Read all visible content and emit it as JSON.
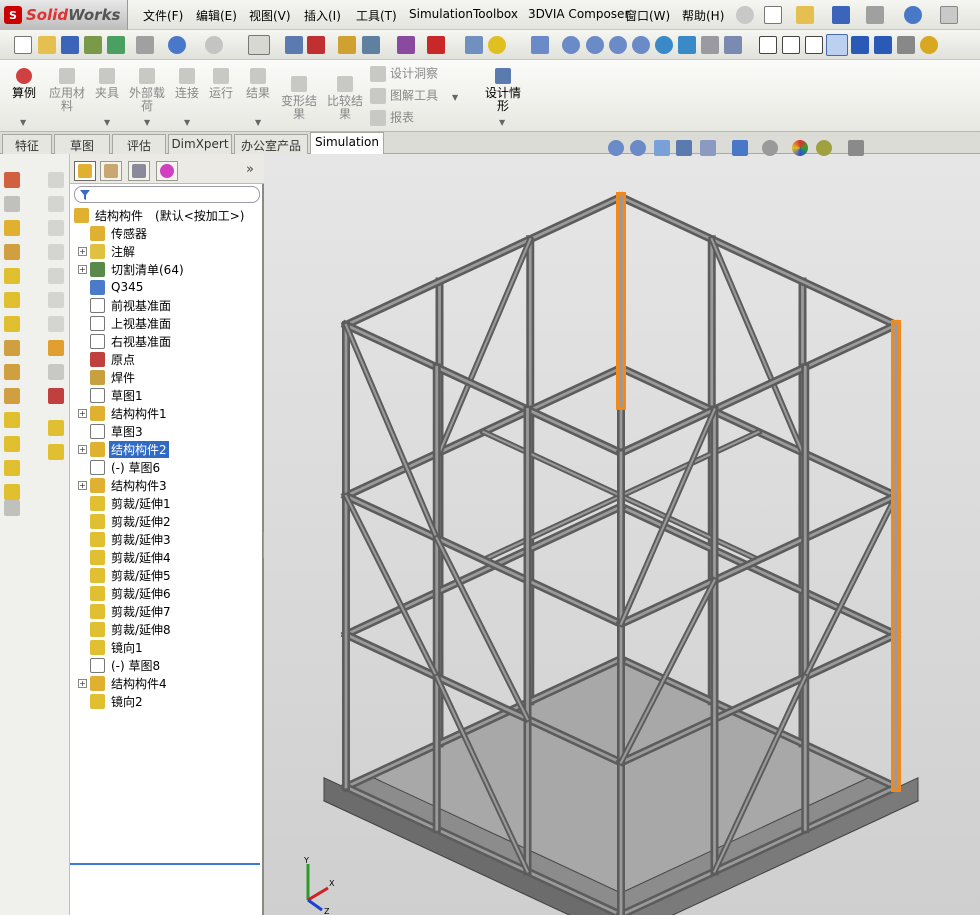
{
  "app": {
    "name_red": "Solid",
    "name_gray": "Works"
  },
  "menu": [
    "文件(F)",
    "编辑(E)",
    "视图(V)",
    "插入(I)",
    "工具(T)",
    "Simulation",
    "Toolbox",
    "3DVIA Composer",
    "窗口(W)",
    "帮助(H)"
  ],
  "commands": [
    {
      "label": "算例",
      "enabled": true
    },
    {
      "label": "应用材料",
      "enabled": false
    },
    {
      "label": "夹具",
      "enabled": false
    },
    {
      "label": "外部载荷",
      "enabled": false
    },
    {
      "label": "连接",
      "enabled": false
    },
    {
      "label": "运行",
      "enabled": false
    },
    {
      "label": "结果",
      "enabled": false
    },
    {
      "label": "变形结果",
      "enabled": false
    },
    {
      "label": "比较结果",
      "enabled": false
    },
    {
      "label": "设计洞察",
      "enabled": false
    },
    {
      "label": "图解工具",
      "enabled": false
    },
    {
      "label": "报表",
      "enabled": false
    },
    {
      "label": "设计情形",
      "enabled": true
    }
  ],
  "tabs": [
    {
      "label": "特征",
      "active": false
    },
    {
      "label": "草图",
      "active": false
    },
    {
      "label": "评估",
      "active": false
    },
    {
      "label": "DimXpert",
      "active": false
    },
    {
      "label": "办公室产品",
      "active": false
    },
    {
      "label": "Simulation",
      "active": true
    }
  ],
  "tree": {
    "root": {
      "label": "结构构件",
      "config": "(默认<按加工>)"
    },
    "nodes": [
      {
        "label": "传感器",
        "expandable": false,
        "icon": "sensor-icon",
        "selected": false
      },
      {
        "label": "注解",
        "expandable": true,
        "icon": "annotation-icon",
        "selected": false
      },
      {
        "label": "切割清单(64)",
        "expandable": true,
        "icon": "cutlist-icon",
        "selected": false
      },
      {
        "label": "Q345",
        "expandable": false,
        "icon": "material-icon",
        "selected": false
      },
      {
        "label": "前视基准面",
        "expandable": false,
        "icon": "plane-icon",
        "selected": false
      },
      {
        "label": "上视基准面",
        "expandable": false,
        "icon": "plane-icon",
        "selected": false
      },
      {
        "label": "右视基准面",
        "expandable": false,
        "icon": "plane-icon",
        "selected": false
      },
      {
        "label": "原点",
        "expandable": false,
        "icon": "origin-icon",
        "selected": false
      },
      {
        "label": "焊件",
        "expandable": false,
        "icon": "weldment-icon",
        "selected": false
      },
      {
        "label": "草图1",
        "expandable": false,
        "icon": "sketch-icon",
        "selected": false
      },
      {
        "label": "结构构件1",
        "expandable": true,
        "icon": "structural-member-icon",
        "selected": false
      },
      {
        "label": "草图3",
        "expandable": false,
        "icon": "sketch-icon",
        "selected": false
      },
      {
        "label": "结构构件2",
        "expandable": true,
        "icon": "structural-member-icon",
        "selected": true
      },
      {
        "label": "(-) 草图6",
        "expandable": false,
        "icon": "sketch-icon",
        "selected": false
      },
      {
        "label": "结构构件3",
        "expandable": true,
        "icon": "structural-member-icon",
        "selected": false
      },
      {
        "label": "剪裁/延伸1",
        "expandable": false,
        "icon": "trim-icon",
        "selected": false
      },
      {
        "label": "剪裁/延伸2",
        "expandable": false,
        "icon": "trim-icon",
        "selected": false
      },
      {
        "label": "剪裁/延伸3",
        "expandable": false,
        "icon": "trim-icon",
        "selected": false
      },
      {
        "label": "剪裁/延伸4",
        "expandable": false,
        "icon": "trim-icon",
        "selected": false
      },
      {
        "label": "剪裁/延伸5",
        "expandable": false,
        "icon": "trim-icon",
        "selected": false
      },
      {
        "label": "剪裁/延伸6",
        "expandable": false,
        "icon": "trim-icon",
        "selected": false
      },
      {
        "label": "剪裁/延伸7",
        "expandable": false,
        "icon": "trim-icon",
        "selected": false
      },
      {
        "label": "剪裁/延伸8",
        "expandable": false,
        "icon": "trim-icon",
        "selected": false
      },
      {
        "label": "镜向1",
        "expandable": false,
        "icon": "mirror-icon",
        "selected": false
      },
      {
        "label": "(-) 草图8",
        "expandable": false,
        "icon": "sketch-icon",
        "selected": false
      },
      {
        "label": "结构构件4",
        "expandable": true,
        "icon": "structural-member-icon",
        "selected": false
      },
      {
        "label": "镜向2",
        "expandable": false,
        "icon": "mirror-icon",
        "selected": false
      }
    ]
  },
  "triad": {
    "x": "X",
    "y": "Y",
    "z": "Z"
  },
  "colors": {
    "highlight": "#f08a1c",
    "frame": "#5c5c5c",
    "selection": "#316ac5"
  }
}
